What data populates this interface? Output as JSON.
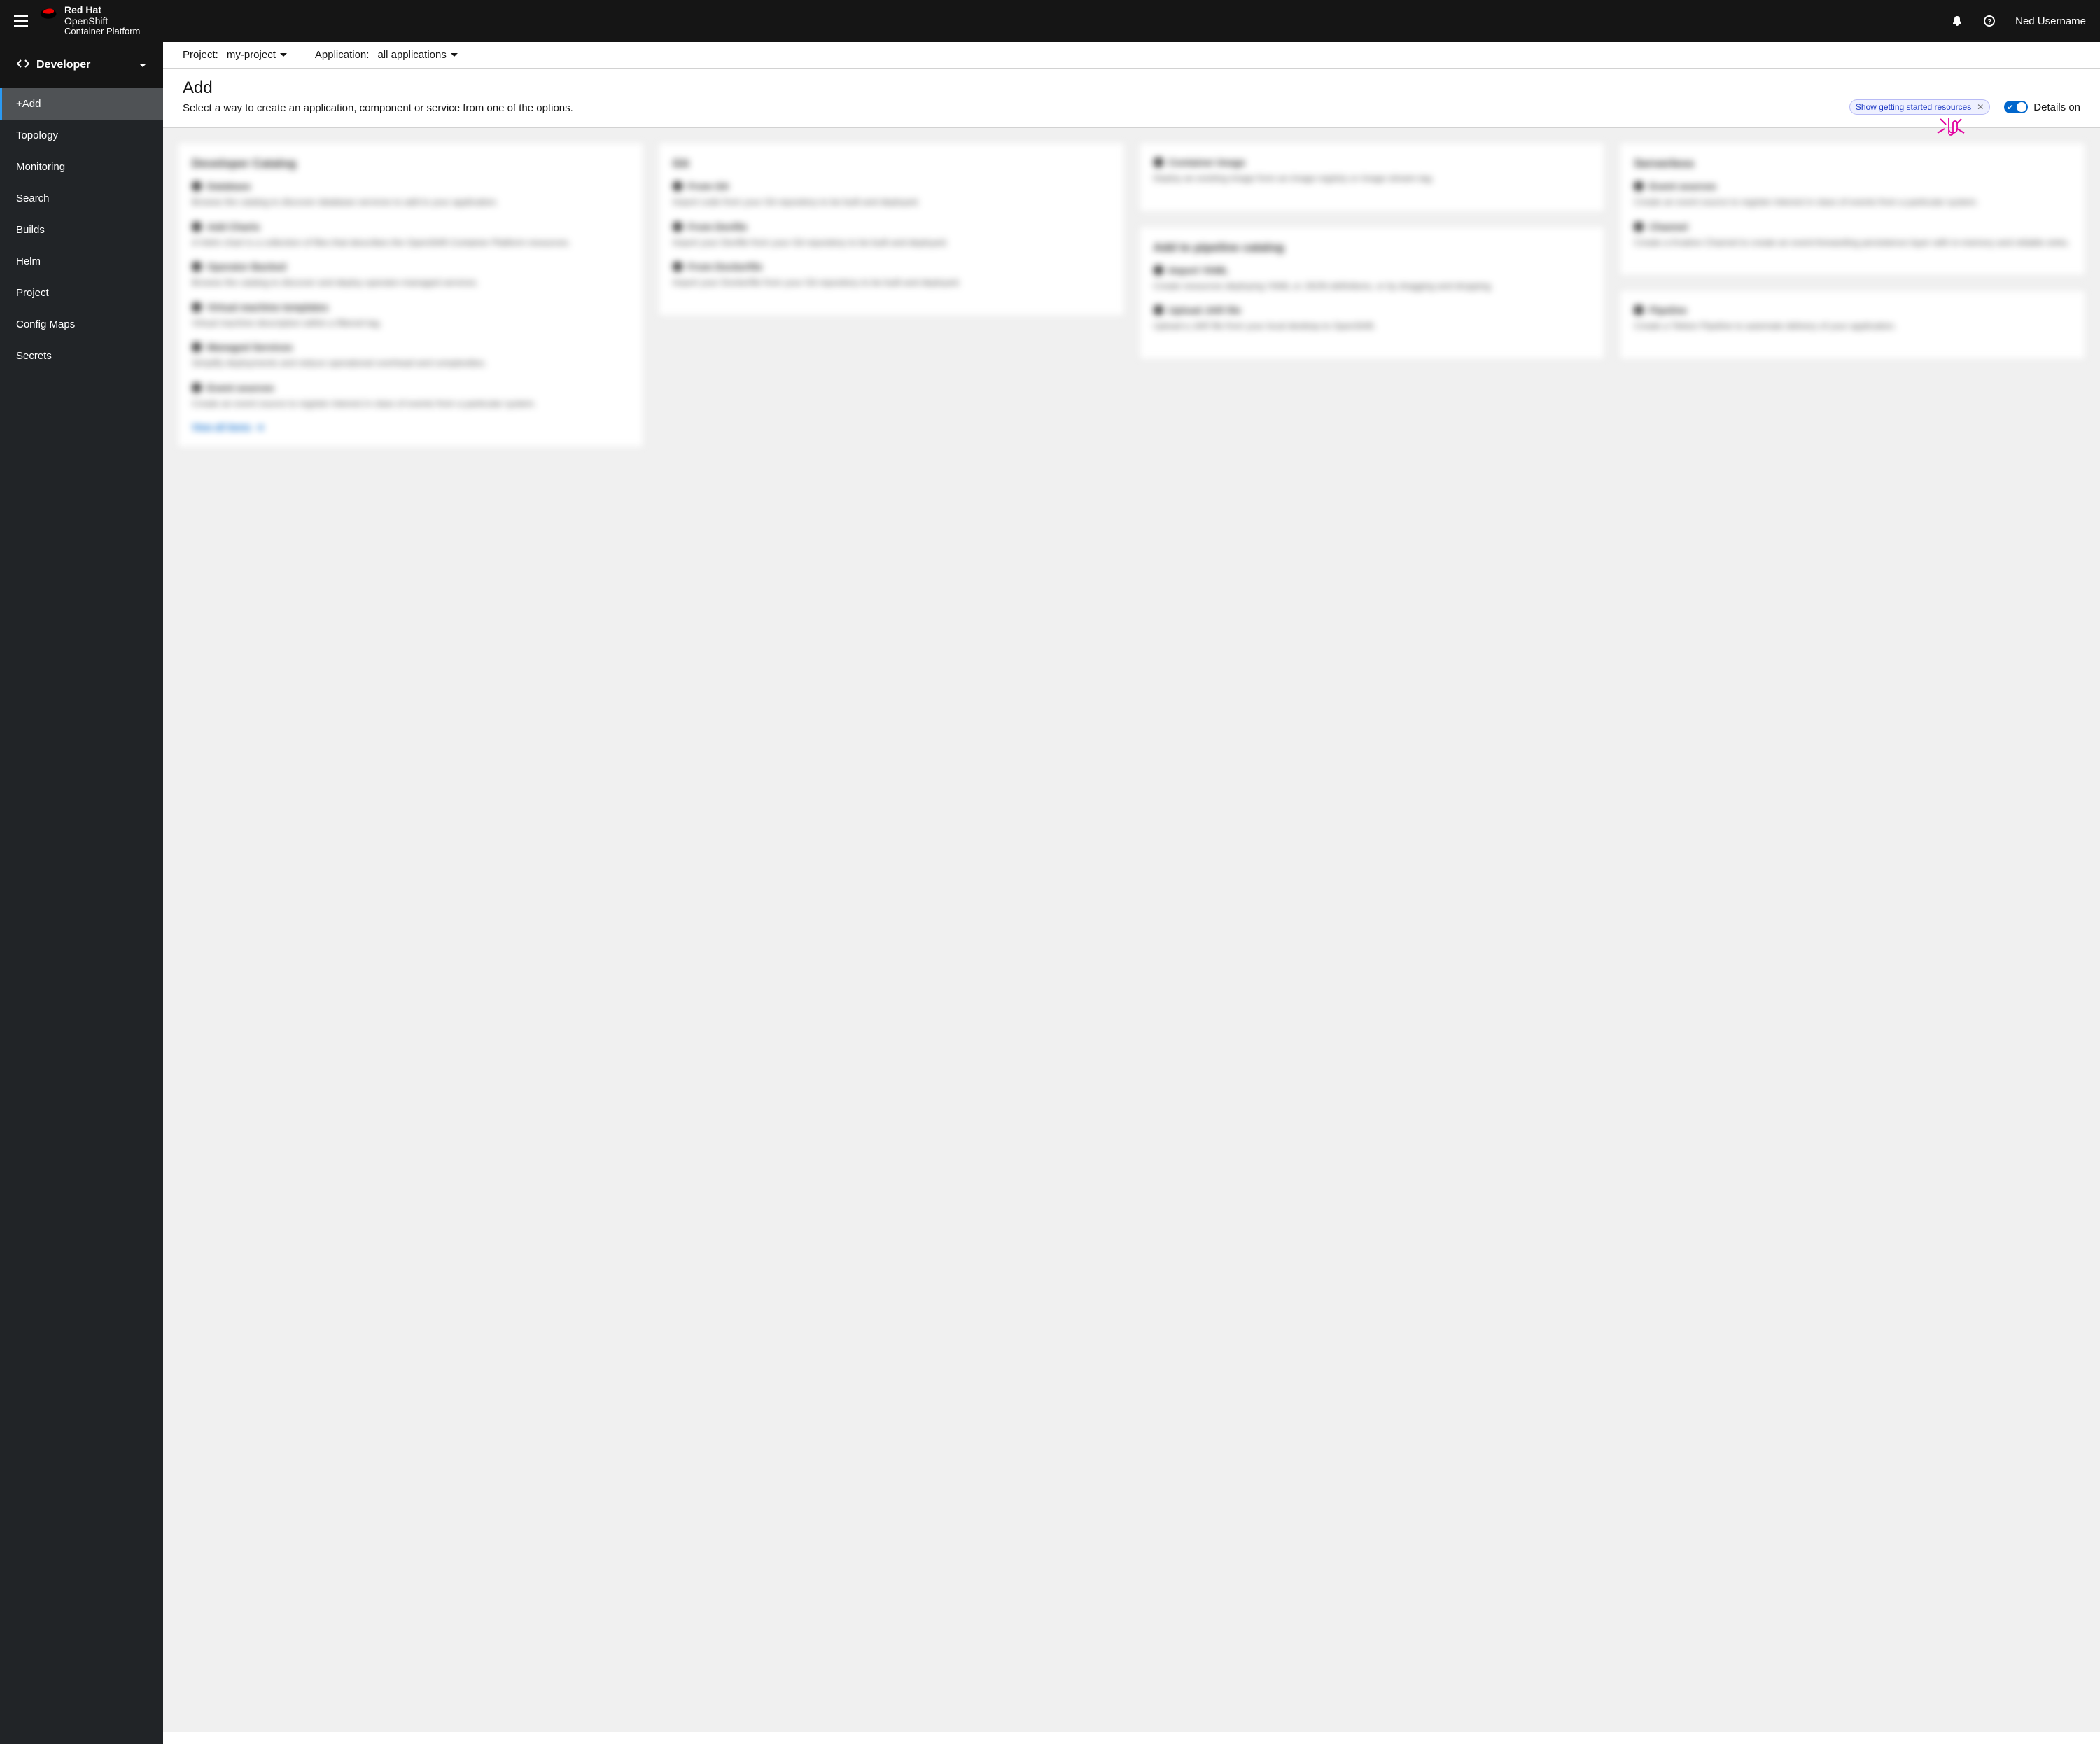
{
  "masthead": {
    "brand_line1a": "Red Hat",
    "brand_line1b": "OpenShift",
    "brand_line2": "Container Platform",
    "username": "Ned Username"
  },
  "perspective": {
    "label": "Developer"
  },
  "nav": {
    "items": [
      {
        "label": "+Add",
        "active": true
      },
      {
        "label": "Topology"
      },
      {
        "label": "Monitoring"
      },
      {
        "label": "Search"
      },
      {
        "label": "Builds"
      },
      {
        "label": "Helm"
      },
      {
        "label": "Project"
      },
      {
        "label": "Config Maps"
      },
      {
        "label": "Secrets"
      }
    ]
  },
  "context": {
    "project_label": "Project:",
    "project_value": "my-project",
    "application_label": "Application:",
    "application_value": "all applications"
  },
  "page": {
    "title": "Add",
    "subtitle": "Select a way to create an application, component or service from one of the options."
  },
  "callouts": {
    "getting_started_pill": "Show getting started resources",
    "details_toggle_label": "Details on"
  }
}
